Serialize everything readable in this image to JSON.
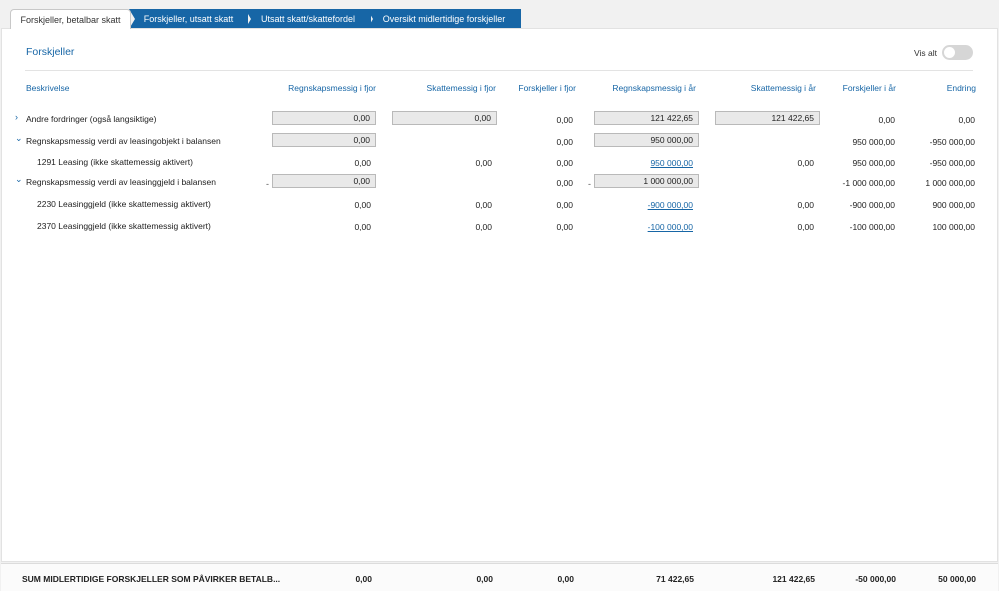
{
  "tabs": [
    {
      "label": "Forskjeller, betalbar skatt"
    },
    {
      "label": "Forskjeller, utsatt skatt"
    },
    {
      "label": "Utsatt skatt/skattefordel"
    },
    {
      "label": "Oversikt midlertidige forskjeller"
    }
  ],
  "panel": {
    "title": "Forskjeller",
    "vis_alt_label": "Vis alt"
  },
  "columns": [
    "Beskrivelse",
    "Regnskapsmessig i fjor",
    "Skattemessig i fjor",
    "Forskjeller i fjor",
    "Regnskapsmessig i år",
    "Skattemessig i år",
    "Forskjeller i år",
    "Endring"
  ],
  "rows": [
    {
      "desc": "Andre fordringer (også langsiktige)",
      "rf": "0,00",
      "sf": "0,00",
      "ff": "0,00",
      "ra": "121 422,65",
      "sa": "121 422,65",
      "fa": "0,00",
      "end": "0,00"
    },
    {
      "desc": "Regnskapsmessig verdi av leasingobjekt i balansen",
      "rf": "0,00",
      "ff": "0,00",
      "ra": "950 000,00",
      "fa": "950 000,00",
      "end": "-950 000,00"
    },
    {
      "desc": "1291 Leasing (ikke skattemessig aktivert)",
      "rf": "0,00",
      "sf": "0,00",
      "ff": "0,00",
      "ra": "950 000,00",
      "sa": "0,00",
      "fa": "950 000,00",
      "end": "-950 000,00"
    },
    {
      "desc": "Regnskapsmessig verdi av leasinggjeld i balansen",
      "rf_sign": "-",
      "rf": "0,00",
      "ff": "0,00",
      "ra_sign": "-",
      "ra": "1 000 000,00",
      "fa": "-1 000 000,00",
      "end": "1 000 000,00"
    },
    {
      "desc": "2230 Leasinggjeld (ikke skattemessig aktivert)",
      "rf": "0,00",
      "sf": "0,00",
      "ff": "0,00",
      "ra": "-900 000,00",
      "sa": "0,00",
      "fa": "-900 000,00",
      "end": "900 000,00"
    },
    {
      "desc": "2370 Leasinggjeld (ikke skattemessig aktivert)",
      "rf": "0,00",
      "sf": "0,00",
      "ff": "0,00",
      "ra": "-100 000,00",
      "sa": "0,00",
      "fa": "-100 000,00",
      "end": "100 000,00"
    }
  ],
  "footer": {
    "label": "SUM MIDLERTIDIGE FORSKJELLER SOM PÅVIRKER BETALB...",
    "rf": "0,00",
    "sf": "0,00",
    "ff": "0,00",
    "ra": "71 422,65",
    "sa": "121 422,65",
    "fa": "-50 000,00",
    "end": "50 000,00"
  },
  "colors": {
    "accent": "#1766a6"
  },
  "icons": {
    "expand": "chevron-right-icon",
    "collapse": "chevron-down-icon"
  }
}
